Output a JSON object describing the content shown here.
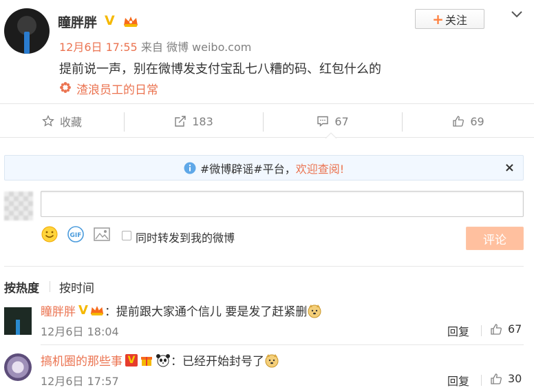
{
  "post": {
    "author": "瞳胖胖",
    "verified_badge": "V",
    "follow_label": "关注",
    "time": "12月6日 17:55",
    "via_prefix": "来自",
    "via_source": "微博 weibo.com",
    "text": "提前说一声，别在微博发支付宝乱七八糟的码、红包什么的",
    "topic": "渣浪员工的日常"
  },
  "actions": {
    "favorite_label": "收藏",
    "repost_count": "183",
    "comment_count": "67",
    "like_count": "69"
  },
  "notice": {
    "part1": "#微博辟谣#平台，",
    "part2": "欢迎查阅!",
    "close": "×"
  },
  "composer": {
    "repost_label": "同时转发到我的微博",
    "submit_label": "评论",
    "gif_label": "GIF"
  },
  "sort": {
    "hot": "按热度",
    "time": "按时间"
  },
  "comments": [
    {
      "name": "瞳胖胖",
      "badge": "V",
      "text": "：提前跟大家通个信儿  要是发了赶紧删",
      "time": "12月6日 18:04",
      "reply_label": "回复",
      "likes": "67"
    },
    {
      "name": "搞机圈的那些事",
      "badge": "V",
      "text": "：已经开始封号了",
      "time": "12月6日 17:57",
      "reply_label": "回复",
      "likes": "30"
    }
  ],
  "colors": {
    "accent_orange": "#eb7350",
    "verified_gold": "#f5b800",
    "notice_bg": "#f2f8ff",
    "submit_disabled": "#ffc09f"
  }
}
